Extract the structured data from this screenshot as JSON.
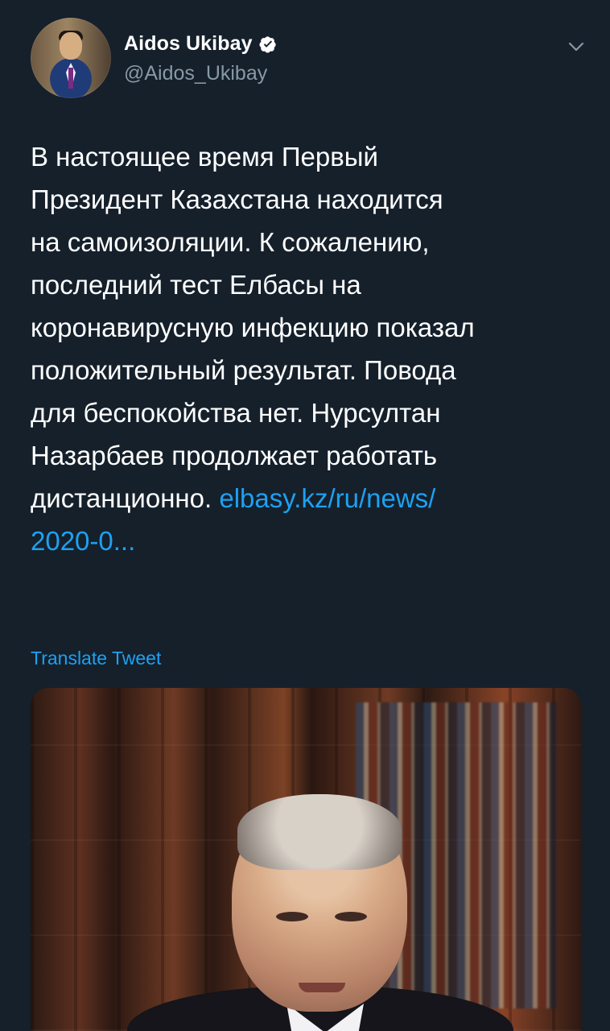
{
  "tweet": {
    "author": {
      "display_name": "Aidos Ukibay",
      "handle": "@Aidos_Ukibay",
      "verified": true
    },
    "text": "В настоящее время Первый\nПрезидент Казахстана находится\nна самоизоляции. К сожалению,\nпоследний тест Елбасы на\nкоронавирусную инфекцию показал\nположительный результат. Повода\nдля беспокойства нет. Нурсултан\nНазарбаев продолжает работать\nдистанционно. ",
    "link": "elbasy.kz/ru/news/\n2020-0...",
    "translate_label": "Translate Tweet"
  },
  "icons": {
    "verified": "verified-badge-icon",
    "menu": "chevron-down-icon"
  },
  "colors": {
    "background": "#15202b",
    "text_primary": "#ffffff",
    "text_secondary": "#8899a6",
    "link": "#1da1f2"
  }
}
